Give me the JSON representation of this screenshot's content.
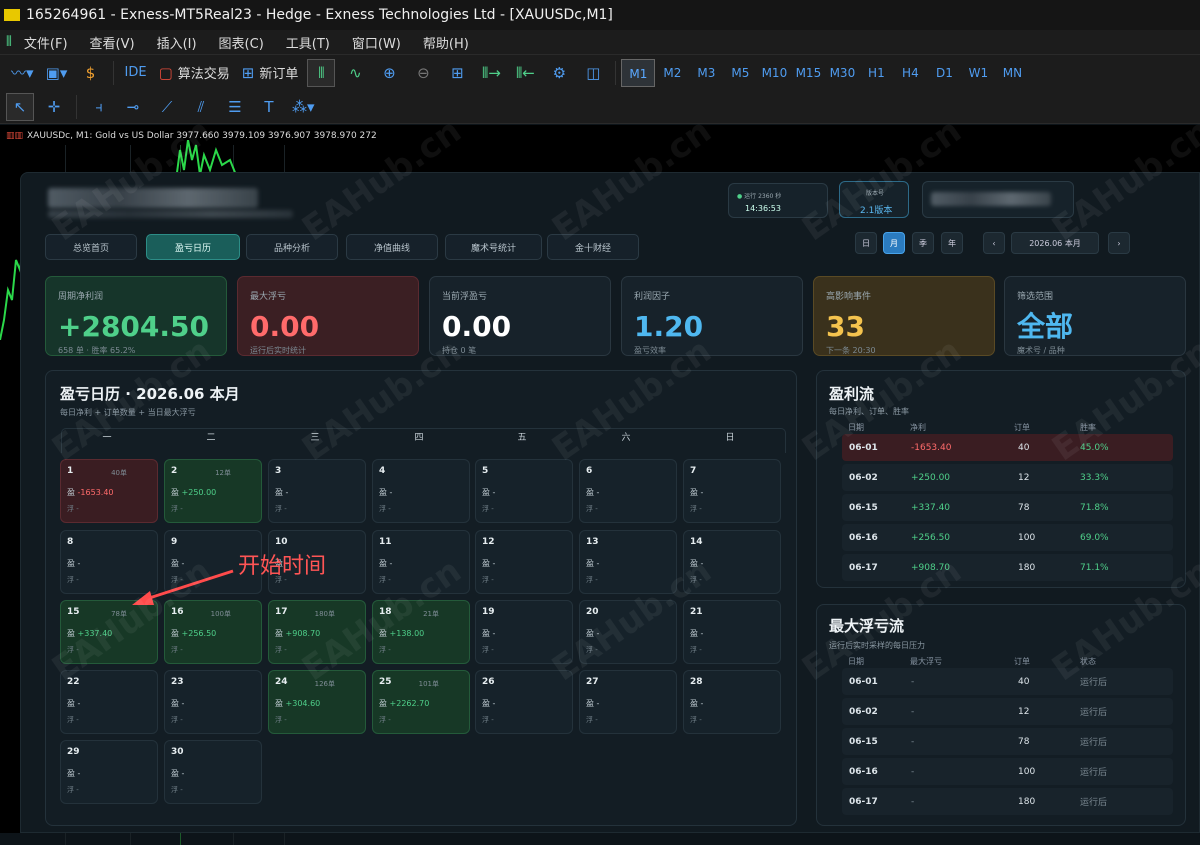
{
  "window": {
    "title": "165264961 - Exness-MT5Real23 - Hedge - Exness Technologies Ltd - [XAUUSDc,M1]"
  },
  "menu": [
    "文件(F)",
    "查看(V)",
    "插入(I)",
    "图表(C)",
    "工具(T)",
    "窗口(W)",
    "帮助(H)"
  ],
  "toolbar": {
    "ide": "IDE",
    "algo": "算法交易",
    "new_order": "新订单"
  },
  "timeframes": [
    "M1",
    "M2",
    "M3",
    "M5",
    "M10",
    "M15",
    "M30",
    "H1",
    "H4",
    "D1",
    "W1",
    "MN"
  ],
  "active_timeframe": "M1",
  "chart_info": "XAUUSDc, M1:  Gold vs US Dollar  3977.660 3979.109 3976.907 3978.970  272",
  "header": {
    "status_label": "运行 2360 秒",
    "time": "14:36:53",
    "version_label": "版本号",
    "version": "2.1版本",
    "blurred_sub": "月份 · XAUUSD"
  },
  "tabs": [
    "总览首页",
    "盈亏日历",
    "品种分析",
    "净值曲线",
    "魔术号统计",
    "金十财经"
  ],
  "active_tab": "盈亏日历",
  "periods": [
    "日",
    "月",
    "季",
    "年"
  ],
  "active_period": "月",
  "period_nav": {
    "prev": "‹",
    "current": "2026.06 本月",
    "next": "›"
  },
  "cards": [
    {
      "label": "周期净利润",
      "value": "+2804.50",
      "sub": "658 单 · 胜率 65.2%",
      "color": "#4fd08a",
      "bg": "#16352a",
      "border": "#245a3a"
    },
    {
      "label": "最大浮亏",
      "value": "0.00",
      "sub": "运行后实时统计",
      "color": "#ff6b6b",
      "bg": "#3b1f23",
      "border": "#5b2a30"
    },
    {
      "label": "当前浮盈亏",
      "value": "0.00",
      "sub": "持仓 0 笔",
      "color": "#ffffff",
      "bg": "#17222a",
      "border": "#2a3740"
    },
    {
      "label": "利润因子",
      "value": "1.20",
      "sub": "盈亏效率",
      "color": "#4fb8f0",
      "bg": "#17222a",
      "border": "#2a3740"
    },
    {
      "label": "高影响事件",
      "value": "33",
      "sub": "下一条 20:30",
      "color": "#f4c34e",
      "bg": "#3a311c",
      "border": "#5a4a24"
    },
    {
      "label": "筛选范围",
      "value": "全部",
      "sub": "魔术号 / 品种",
      "color": "#4fb8f0",
      "bg": "#17222a",
      "border": "#2a3740"
    }
  ],
  "calendar": {
    "title": "盈亏日历 · 2026.06 本月",
    "subtitle": "每日净利 + 订单数量 + 当日最大浮亏",
    "weekdays": [
      "一",
      "二",
      "三",
      "四",
      "五",
      "六",
      "日"
    ],
    "pnl_prefix": "盈",
    "float_prefix": "浮 -",
    "days": [
      {
        "d": "1",
        "cnt": "40单",
        "pnl": "-1653.40",
        "type": "red"
      },
      {
        "d": "2",
        "cnt": "12单",
        "pnl": "+250.00",
        "type": "green"
      },
      {
        "d": "3",
        "cnt": "",
        "pnl": "-",
        "type": ""
      },
      {
        "d": "4",
        "cnt": "",
        "pnl": "-",
        "type": ""
      },
      {
        "d": "5",
        "cnt": "",
        "pnl": "-",
        "type": ""
      },
      {
        "d": "6",
        "cnt": "",
        "pnl": "-",
        "type": ""
      },
      {
        "d": "7",
        "cnt": "",
        "pnl": "-",
        "type": ""
      },
      {
        "d": "8",
        "cnt": "",
        "pnl": "-",
        "type": ""
      },
      {
        "d": "9",
        "cnt": "",
        "pnl": "-",
        "type": ""
      },
      {
        "d": "10",
        "cnt": "",
        "pnl": "-",
        "type": ""
      },
      {
        "d": "11",
        "cnt": "",
        "pnl": "-",
        "type": ""
      },
      {
        "d": "12",
        "cnt": "",
        "pnl": "-",
        "type": ""
      },
      {
        "d": "13",
        "cnt": "",
        "pnl": "-",
        "type": ""
      },
      {
        "d": "14",
        "cnt": "",
        "pnl": "-",
        "type": ""
      },
      {
        "d": "15",
        "cnt": "78单",
        "pnl": "+337.40",
        "type": "green"
      },
      {
        "d": "16",
        "cnt": "100单",
        "pnl": "+256.50",
        "type": "green"
      },
      {
        "d": "17",
        "cnt": "180单",
        "pnl": "+908.70",
        "type": "green"
      },
      {
        "d": "18",
        "cnt": "21单",
        "pnl": "+138.00",
        "type": "green"
      },
      {
        "d": "19",
        "cnt": "",
        "pnl": "-",
        "type": ""
      },
      {
        "d": "20",
        "cnt": "",
        "pnl": "-",
        "type": ""
      },
      {
        "d": "21",
        "cnt": "",
        "pnl": "-",
        "type": ""
      },
      {
        "d": "22",
        "cnt": "",
        "pnl": "-",
        "type": ""
      },
      {
        "d": "23",
        "cnt": "",
        "pnl": "-",
        "type": ""
      },
      {
        "d": "24",
        "cnt": "126单",
        "pnl": "+304.60",
        "type": "green"
      },
      {
        "d": "25",
        "cnt": "101单",
        "pnl": "+2262.70",
        "type": "green"
      },
      {
        "d": "26",
        "cnt": "",
        "pnl": "-",
        "type": ""
      },
      {
        "d": "27",
        "cnt": "",
        "pnl": "-",
        "type": ""
      },
      {
        "d": "28",
        "cnt": "",
        "pnl": "-",
        "type": ""
      },
      {
        "d": "29",
        "cnt": "",
        "pnl": "-",
        "type": ""
      },
      {
        "d": "30",
        "cnt": "",
        "pnl": "-",
        "type": ""
      }
    ]
  },
  "annotation": {
    "text": "开始时间"
  },
  "profit_flow": {
    "title": "盈利流",
    "subtitle": "每日净利、订单、胜率",
    "headers": [
      "日期",
      "净利",
      "订单",
      "胜率"
    ],
    "rows": [
      {
        "date": "06-01",
        "pnl": "-1653.40",
        "orders": "40",
        "win": "45.0%",
        "type": "red"
      },
      {
        "date": "06-02",
        "pnl": "+250.00",
        "orders": "12",
        "win": "33.3%",
        "type": ""
      },
      {
        "date": "06-15",
        "pnl": "+337.40",
        "orders": "78",
        "win": "71.8%",
        "type": ""
      },
      {
        "date": "06-16",
        "pnl": "+256.50",
        "orders": "100",
        "win": "69.0%",
        "type": ""
      },
      {
        "date": "06-17",
        "pnl": "+908.70",
        "orders": "180",
        "win": "71.1%",
        "type": ""
      }
    ]
  },
  "max_float": {
    "title": "最大浮亏流",
    "subtitle": "运行后实时采样的每日压力",
    "headers": [
      "日期",
      "最大浮亏",
      "订单",
      "状态"
    ],
    "rows": [
      {
        "date": "06-01",
        "loss": "-",
        "orders": "40",
        "status": "运行后"
      },
      {
        "date": "06-02",
        "loss": "-",
        "orders": "12",
        "status": "运行后"
      },
      {
        "date": "06-15",
        "loss": "-",
        "orders": "78",
        "status": "运行后"
      },
      {
        "date": "06-16",
        "loss": "-",
        "orders": "100",
        "status": "运行后"
      },
      {
        "date": "06-17",
        "loss": "-",
        "orders": "180",
        "status": "运行后"
      }
    ]
  },
  "watermark": "EAHub.cn"
}
